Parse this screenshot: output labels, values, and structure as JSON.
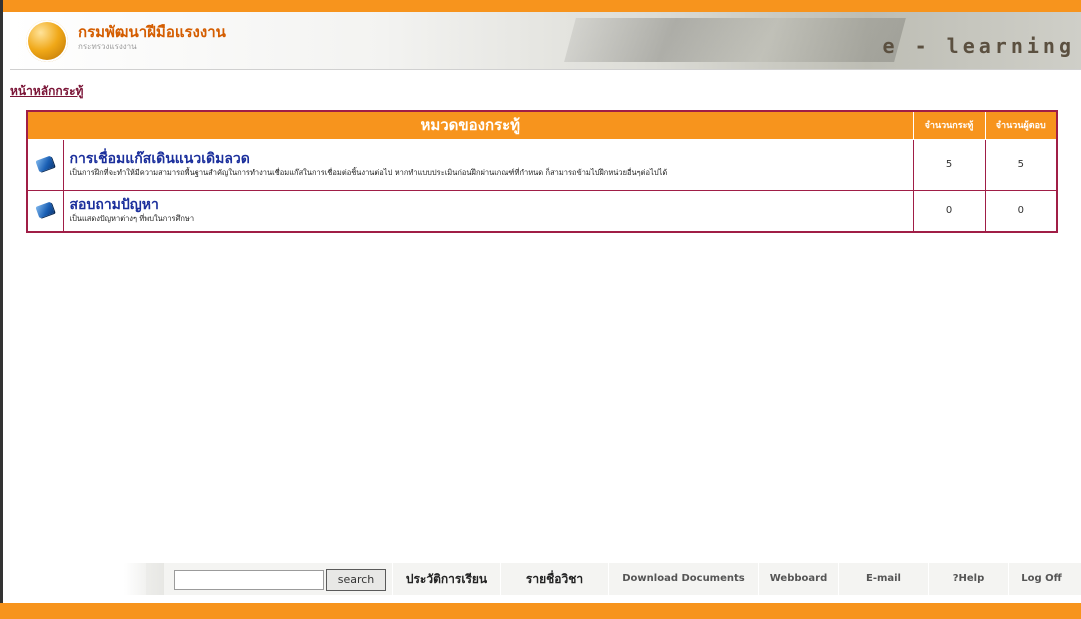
{
  "header": {
    "org_name": "กรมพัฒนาฝีมือแรงงาน",
    "org_sub": "กระทรวงแรงงาน",
    "elearning": "e - learning"
  },
  "breadcrumb": "หน้าหลักกระทู้",
  "table": {
    "headers": {
      "category": "หมวดของกระทู้",
      "topics": "จำนวนกระทู้",
      "replies": "จำนวนผู้ตอบ"
    },
    "rows": [
      {
        "icon": "book-icon",
        "title": "การเชื่อมแก๊สเดินแนวเดิมลวด",
        "desc": "เป็นการฝึกที่จะทำให้มีความสามารถพื้นฐานสำคัญในการทำงานเชื่อมแก๊สในการเชื่อมต่อชิ้นงานต่อไป หากทำแบบประเมินก่อนฝึกผ่านเกณฑ์ที่กำหนด ก็สามารถข้ามไปฝึกหน่วยอื่นๆต่อไปได้",
        "topics": "5",
        "replies": "5"
      },
      {
        "icon": "book-icon",
        "title": "สอบถามปัญหา",
        "desc": "เป็นแสดงปัญหาต่างๆ ที่พบในการศึกษา",
        "topics": "0",
        "replies": "0"
      }
    ]
  },
  "bottom_nav": {
    "search_placeholder": "",
    "search_button": "search",
    "items": [
      "ประวัติการเรียน",
      "รายชื่อวิชา",
      "Download Documents",
      "Webboard",
      "E-mail",
      "?Help",
      "Log Off"
    ]
  },
  "colors": {
    "accent": "#f7941d",
    "border": "#a01e46",
    "title_blue": "#1b2f9c"
  }
}
